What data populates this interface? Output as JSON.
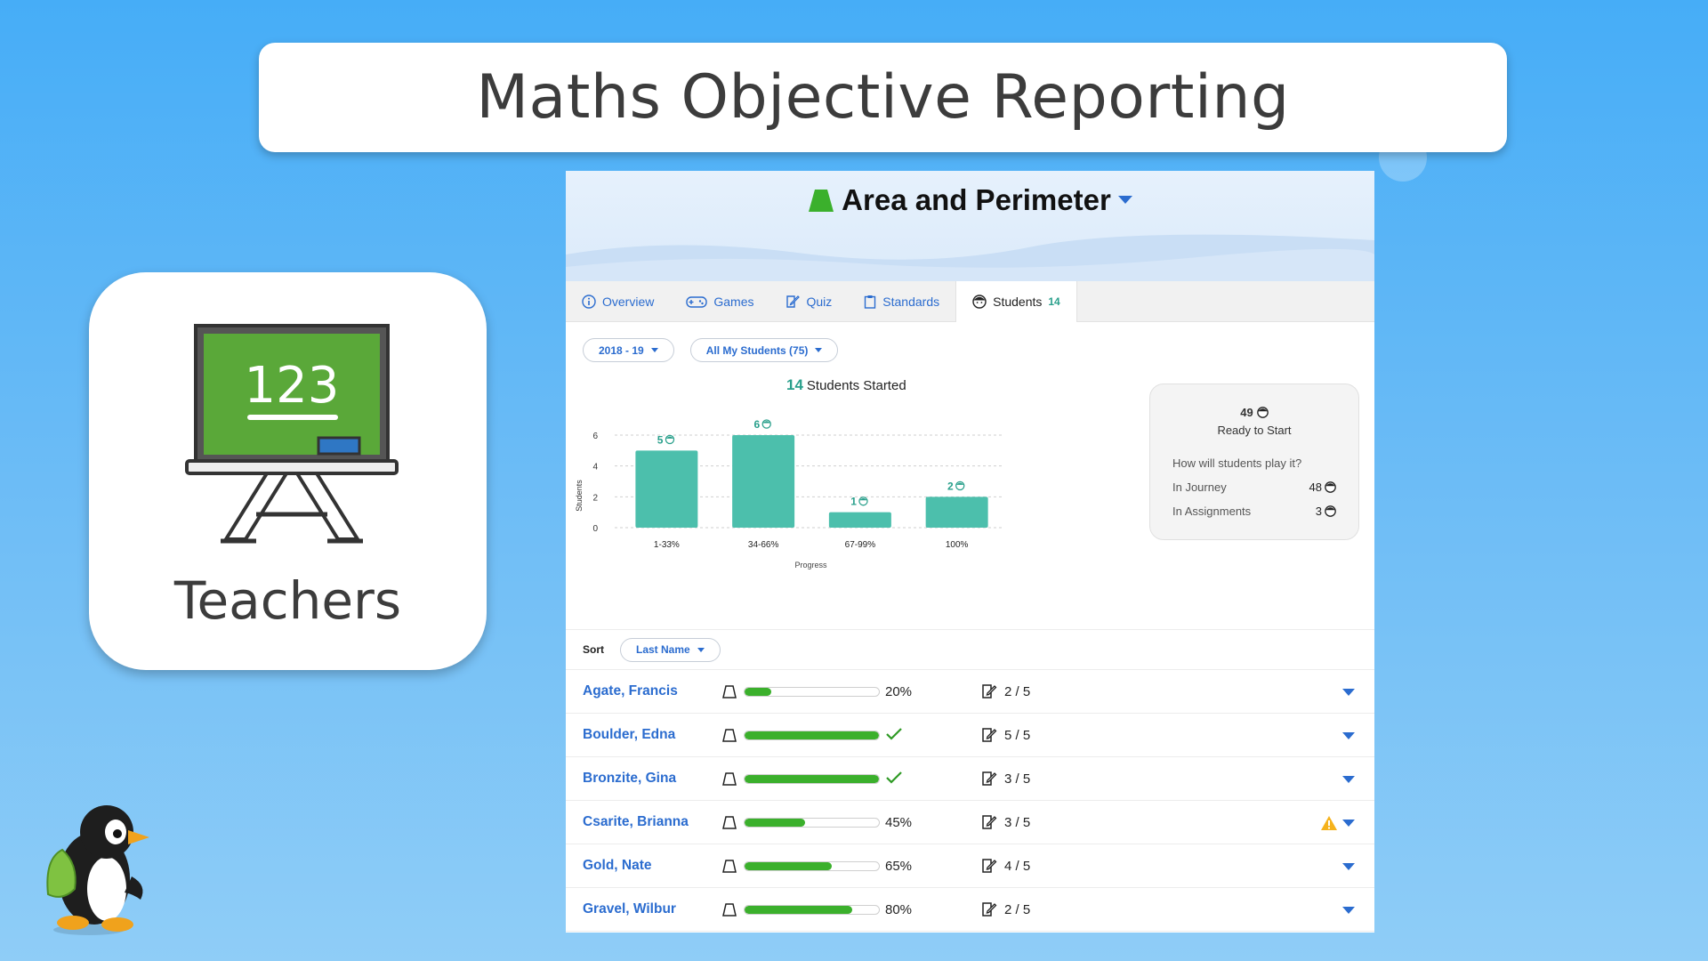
{
  "title": "Maths Objective Reporting",
  "teacher_card": {
    "board_text": "123",
    "label": "Teachers"
  },
  "app": {
    "topic": "Area and Perimeter",
    "tabs": [
      {
        "label": "Overview",
        "icon": "info-icon"
      },
      {
        "label": "Games",
        "icon": "gamepad-icon"
      },
      {
        "label": "Quiz",
        "icon": "quiz-icon"
      },
      {
        "label": "Standards",
        "icon": "clipboard-icon"
      },
      {
        "label": "Students",
        "icon": "student-face-icon",
        "count": "14"
      }
    ],
    "filters": {
      "year": "2018 - 19",
      "group": "All My Students (75)"
    },
    "chart_header": {
      "count": "14",
      "label": "Students Started"
    },
    "ready": {
      "count": "49",
      "label": "Ready to Start",
      "question": "How will students play it?",
      "journey_label": "In Journey",
      "journey_count": "48",
      "assignments_label": "In Assignments",
      "assignments_count": "3"
    },
    "sort": {
      "label": "Sort",
      "value": "Last Name"
    },
    "students": [
      {
        "name": "Agate, Francis",
        "progress": 20,
        "progress_label": "20%",
        "complete": false,
        "quiz": "2 / 5",
        "warning": false
      },
      {
        "name": "Boulder, Edna",
        "progress": 100,
        "progress_label": "",
        "complete": true,
        "quiz": "5 / 5",
        "warning": false
      },
      {
        "name": "Bronzite, Gina",
        "progress": 100,
        "progress_label": "",
        "complete": true,
        "quiz": "3 / 5",
        "warning": false
      },
      {
        "name": "Csarite, Brianna",
        "progress": 45,
        "progress_label": "45%",
        "complete": false,
        "quiz": "3 / 5",
        "warning": true
      },
      {
        "name": "Gold, Nate",
        "progress": 65,
        "progress_label": "65%",
        "complete": false,
        "quiz": "4 / 5",
        "warning": false
      },
      {
        "name": "Gravel, Wilbur",
        "progress": 80,
        "progress_label": "80%",
        "complete": false,
        "quiz": "2 / 5",
        "warning": false
      }
    ]
  },
  "colors": {
    "bar": "#4cbfac",
    "progress": "#3bb02c",
    "link": "#2b6ccf",
    "accent": "#2aa08c"
  },
  "chart_data": {
    "type": "bar",
    "categories": [
      "1-33%",
      "34-66%",
      "67-99%",
      "100%"
    ],
    "values": [
      5,
      6,
      1,
      2
    ],
    "data_labels": [
      "5",
      "6",
      "1",
      "2"
    ],
    "xlabel": "Progress",
    "ylabel": "Students",
    "yticks": [
      "0",
      "2",
      "4",
      "6"
    ],
    "ylim": [
      0,
      6
    ],
    "grid": true
  }
}
